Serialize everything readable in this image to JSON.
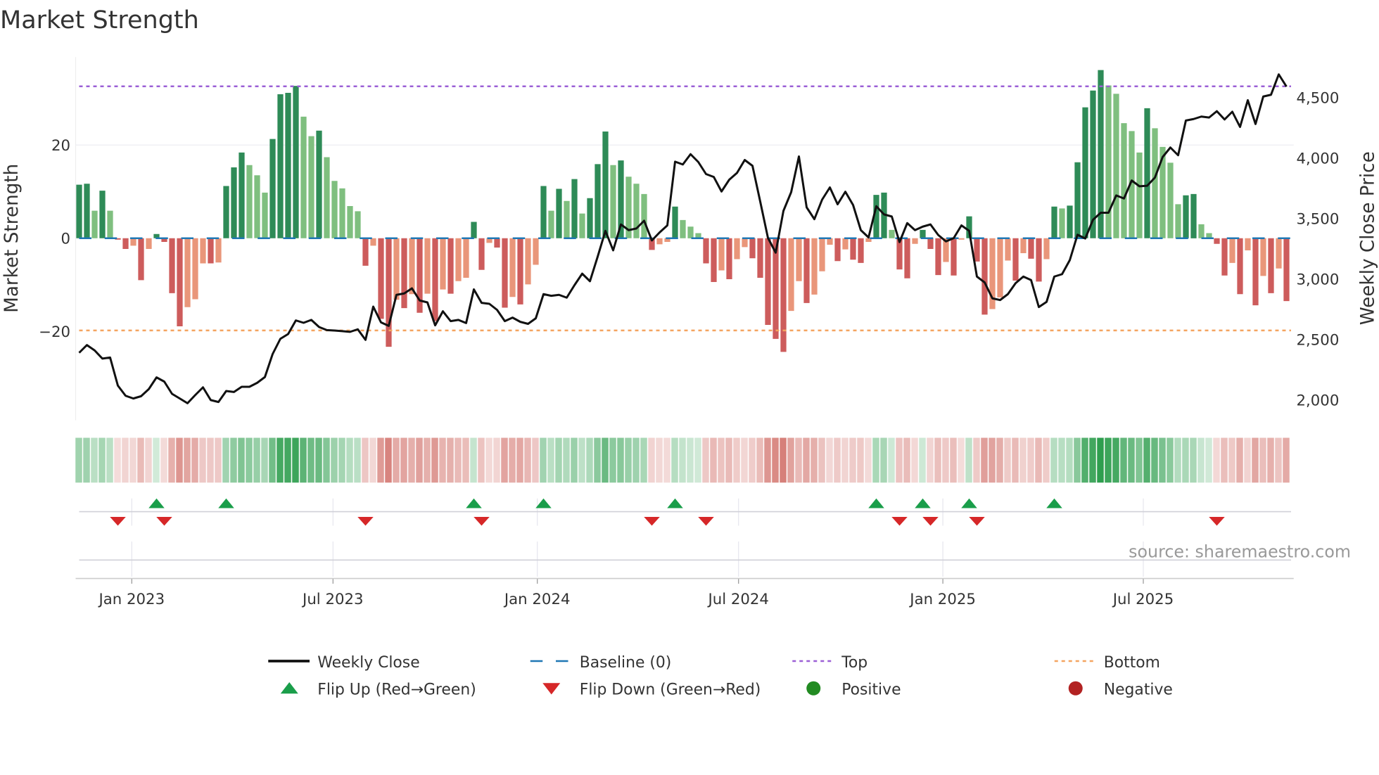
{
  "chart_data": {
    "type": "bar",
    "title": "Market Strength",
    "ylabel": "Market Strength",
    "y2label": "Weekly Close Price",
    "ylim": [
      -39,
      39
    ],
    "y2lim": [
      1833,
      4835
    ],
    "xlim": [
      -0.6,
      156.6
    ],
    "x_unit": "week index (weekly bars)",
    "yticks": [
      {
        "v": 20,
        "label": "20"
      },
      {
        "v": 0,
        "label": "0"
      },
      {
        "v": -20,
        "label": "−20"
      }
    ],
    "y2ticks": [
      {
        "v": 2000,
        "label": "2,000"
      },
      {
        "v": 2500,
        "label": "2,500"
      },
      {
        "v": 3000,
        "label": "3,000"
      },
      {
        "v": 3500,
        "label": "3,500"
      },
      {
        "v": 4000,
        "label": "4,000"
      },
      {
        "v": 4500,
        "label": "4,500"
      }
    ],
    "xticks": [
      {
        "v": 6.8,
        "label": "Jan 2023"
      },
      {
        "v": 32.8,
        "label": "Jul 2023"
      },
      {
        "v": 59.2,
        "label": "Jan 2024"
      },
      {
        "v": 85.2,
        "label": "Jul 2024"
      },
      {
        "v": 111.6,
        "label": "Jan 2025"
      },
      {
        "v": 137.5,
        "label": "Jul 2025"
      }
    ],
    "top_level": 32.6,
    "bottom_level": -19.8,
    "baseline": 0,
    "strength": [
      11.5,
      11.7,
      5.9,
      10.2,
      5.9,
      -0.3,
      -2.3,
      -1.6,
      -9,
      -2.3,
      0.9,
      -0.8,
      -11.8,
      -18.9,
      -14.8,
      -13.1,
      -5.4,
      -5.4,
      -5.2,
      11.2,
      15.2,
      18.4,
      15.7,
      13.5,
      9.8,
      21.3,
      30.9,
      31.2,
      32.7,
      26.1,
      21.9,
      23.1,
      17.4,
      12.3,
      10.7,
      6.9,
      5.8,
      -5.9,
      -1.6,
      -17.3,
      -23.3,
      -13.2,
      -15,
      -12,
      -16,
      -11.9,
      -17.8,
      -11,
      -11.9,
      -9.2,
      -8.5,
      3.5,
      -6.8,
      -1,
      -2,
      -14.9,
      -12.6,
      -14.2,
      -9.9,
      -5.7,
      11.2,
      5.9,
      10.6,
      8,
      12.7,
      5.3,
      8.6,
      15.9,
      22.9,
      15.7,
      16.7,
      13.2,
      11.7,
      9.5,
      -2.5,
      -1.3,
      -0.8,
      6.8,
      3.9,
      2.5,
      1.1,
      -5.4,
      -9.4,
      -6.9,
      -8.8,
      -4.5,
      -1.9,
      -4.3,
      -8.5,
      -18.6,
      -21.6,
      -24.4,
      -15.6,
      -9.2,
      -13.9,
      -12.1,
      -7.1,
      -1.4,
      -4.9,
      -2.4,
      -4.6,
      -5.3,
      -0.8,
      9.3,
      9.8,
      1.8,
      -6.7,
      -8.6,
      -1.2,
      1.8,
      -2.3,
      -7.9,
      -5.1,
      -8,
      -0.3,
      4.7,
      -5,
      -16.4,
      -15.2,
      -12.7,
      -4.8,
      -9.1,
      -3.2,
      -4.4,
      -9.3,
      -4.5,
      6.8,
      6.4,
      7,
      16.3,
      28.1,
      31.7,
      36.1,
      32.8,
      31,
      24.7,
      23,
      18.4,
      27.9,
      23.6,
      19.6,
      16.2,
      7.3,
      9.2,
      9.5,
      3,
      1.1,
      -1.2,
      -8,
      -5.3,
      -12,
      -2.6,
      -14.4,
      -8.1,
      -11.8,
      -6.5,
      -13.5
    ],
    "weekly_close": [
      2390,
      2454,
      2410,
      2342,
      2351,
      2119,
      2035,
      2012,
      2031,
      2090,
      2187,
      2152,
      2051,
      2012,
      1973,
      2041,
      2105,
      1999,
      1983,
      2074,
      2066,
      2109,
      2109,
      2142,
      2190,
      2380,
      2506,
      2545,
      2658,
      2638,
      2662,
      2603,
      2578,
      2574,
      2569,
      2563,
      2584,
      2497,
      2772,
      2642,
      2613,
      2869,
      2881,
      2923,
      2823,
      2807,
      2617,
      2733,
      2652,
      2662,
      2636,
      2914,
      2803,
      2795,
      2745,
      2652,
      2681,
      2646,
      2629,
      2675,
      2875,
      2861,
      2869,
      2846,
      2949,
      3044,
      2982,
      3185,
      3398,
      3237,
      3451,
      3404,
      3418,
      3482,
      3319,
      3385,
      3443,
      3970,
      3947,
      4032,
      3967,
      3868,
      3844,
      3724,
      3821,
      3877,
      3984,
      3936,
      3641,
      3340,
      3218,
      3563,
      3718,
      4013,
      3592,
      3495,
      3656,
      3757,
      3618,
      3722,
      3612,
      3404,
      3344,
      3602,
      3534,
      3517,
      3305,
      3462,
      3404,
      3433,
      3451,
      3364,
      3311,
      3338,
      3443,
      3398,
      3020,
      2972,
      2840,
      2826,
      2875,
      2966,
      3020,
      2991,
      2768,
      2811,
      3020,
      3040,
      3156,
      3366,
      3335,
      3490,
      3548,
      3548,
      3691,
      3666,
      3815,
      3767,
      3771,
      3839,
      4009,
      4087,
      4023,
      4310,
      4323,
      4343,
      4335,
      4387,
      4319,
      4383,
      4257,
      4478,
      4281,
      4509,
      4523,
      4692,
      4591
    ],
    "flip_up_weeks": [
      10,
      19,
      51,
      60,
      77,
      103,
      109,
      115,
      126
    ],
    "flip_down_weeks": [
      5,
      11,
      37,
      52,
      74,
      81,
      106,
      110,
      116,
      147
    ],
    "legend": {
      "placement": "bottom",
      "items": [
        {
          "key": "close",
          "label": "Weekly Close"
        },
        {
          "key": "baseline",
          "label": "Baseline (0)"
        },
        {
          "key": "top",
          "label": "Top"
        },
        {
          "key": "bottom",
          "label": "Bottom"
        },
        {
          "key": "flipup",
          "label": "Flip Up (Red→Green)"
        },
        {
          "key": "flipdown",
          "label": "Flip Down (Green→Red)"
        },
        {
          "key": "positive",
          "label": "Positive"
        },
        {
          "key": "negative",
          "label": "Negative"
        }
      ]
    },
    "source": "source: sharemaestro.com",
    "colors": {
      "pos_strong": "#2e8b57",
      "pos_weak": "#7fbf7f",
      "neg_strong": "#cd5c5c",
      "neg_weak": "#e9967a",
      "close": "#111111",
      "baseline": "#1f77b4",
      "top": "#9b5fd6",
      "bottom": "#f4a460",
      "flip_up": "#1a9e4a",
      "flip_down": "#d62728",
      "positive_dot": "#228b22",
      "negative_dot": "#b22222",
      "strip_pos": "#2e9e4e",
      "strip_neg": "#c8544c"
    }
  }
}
